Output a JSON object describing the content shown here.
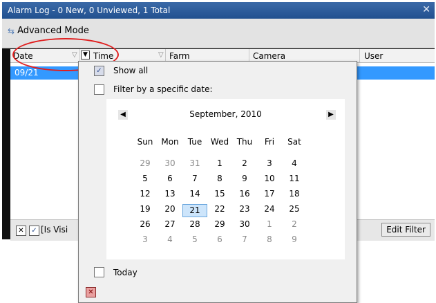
{
  "window": {
    "title": "Alarm Log - 0 New, 0 Unviewed, 1 Total",
    "close_glyph": "✕"
  },
  "toolbar": {
    "mode_icon": "arrows-icon",
    "mode_label": "Advanced Mode"
  },
  "grid": {
    "columns": [
      "Date",
      "Time",
      "Farm",
      "Camera",
      "User"
    ],
    "rows": [
      {
        "date": "09/21"
      }
    ]
  },
  "filter_bar": {
    "text": "[Is Visi",
    "edit_label": "Edit Filter"
  },
  "date_filter": {
    "show_all_label": "Show all",
    "specific_label": "Filter by a specific date:",
    "today_label": "Today",
    "calendar": {
      "month_label": "September, 2010",
      "weekdays": [
        "Sun",
        "Mon",
        "Tue",
        "Wed",
        "Thu",
        "Fri",
        "Sat"
      ],
      "weeks": [
        [
          "29",
          "30",
          "31",
          "1",
          "2",
          "3",
          "4"
        ],
        [
          "5",
          "6",
          "7",
          "8",
          "9",
          "10",
          "11"
        ],
        [
          "12",
          "13",
          "14",
          "15",
          "16",
          "17",
          "18"
        ],
        [
          "19",
          "20",
          "21",
          "22",
          "23",
          "24",
          "25"
        ],
        [
          "26",
          "27",
          "28",
          "29",
          "30",
          "1",
          "2"
        ],
        [
          "3",
          "4",
          "5",
          "6",
          "7",
          "8",
          "9"
        ]
      ],
      "other_month": [
        [
          true,
          true,
          true,
          false,
          false,
          false,
          false
        ],
        [
          false,
          false,
          false,
          false,
          false,
          false,
          false
        ],
        [
          false,
          false,
          false,
          false,
          false,
          false,
          false
        ],
        [
          false,
          false,
          false,
          false,
          false,
          false,
          false
        ],
        [
          false,
          false,
          false,
          false,
          false,
          true,
          true
        ],
        [
          true,
          true,
          true,
          true,
          true,
          true,
          true
        ]
      ],
      "selected_day": "21"
    }
  },
  "colors": {
    "selection": "#3399ff",
    "title_bar": "#2a5a9a",
    "highlight_ring": "#e01e1e"
  }
}
